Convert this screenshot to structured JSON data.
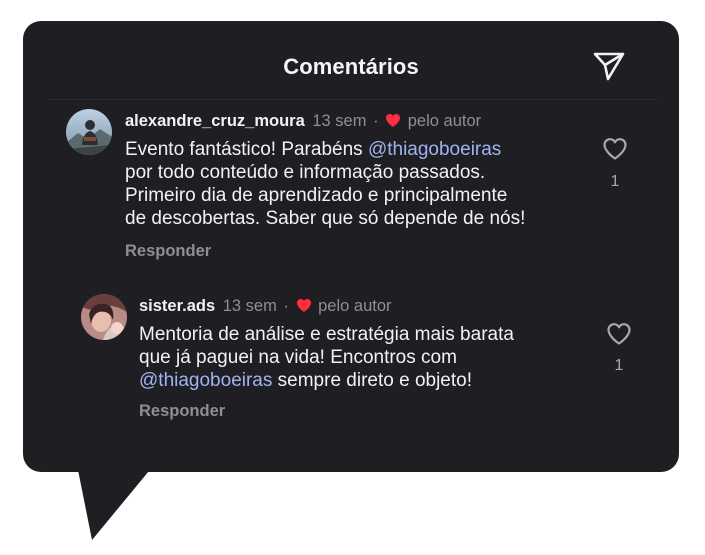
{
  "header": {
    "title": "Comentários",
    "send_icon": "send-icon"
  },
  "colors": {
    "background": "#1f1f23",
    "mention": "#9fb4ee",
    "heart_red": "#ff2d42",
    "muted": "#8e8e93"
  },
  "comments": [
    {
      "username": "alexandre_cruz_moura",
      "time": "13 sem",
      "separator": "·",
      "liked_by_author": "pelo autor",
      "text_lines": [
        {
          "parts": [
            {
              "text": "Evento fantástico! Parabéns ",
              "mention": false
            },
            {
              "text": "@thiagoboeiras",
              "mention": true
            }
          ]
        },
        {
          "parts": [
            {
              "text": "por todo conteúdo e informação passados.",
              "mention": false
            }
          ]
        },
        {
          "parts": [
            {
              "text": "Primeiro dia de aprendizado e principalmente",
              "mention": false
            }
          ]
        },
        {
          "parts": [
            {
              "text": "de descobertas. Saber que só depende de nós!",
              "mention": false
            }
          ]
        }
      ],
      "reply_label": "Responder",
      "like_count": "1"
    },
    {
      "username": "sister.ads",
      "time": "13 sem",
      "separator": "·",
      "liked_by_author": "pelo autor",
      "text_lines": [
        {
          "parts": [
            {
              "text": "Mentoria de análise e estratégia mais barata",
              "mention": false
            }
          ]
        },
        {
          "parts": [
            {
              "text": "que já paguei na vida! Encontros com",
              "mention": false
            }
          ]
        },
        {
          "parts": [
            {
              "text": "@thiagoboeiras",
              "mention": true
            },
            {
              "text": " sempre direto e objeto!",
              "mention": false
            }
          ]
        }
      ],
      "reply_label": "Responder",
      "like_count": "1"
    }
  ]
}
